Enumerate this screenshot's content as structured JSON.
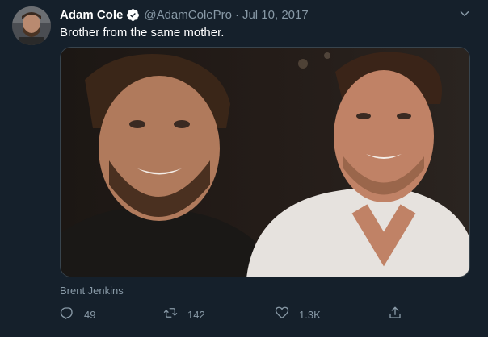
{
  "tweet": {
    "display_name": "Adam Cole",
    "verified": true,
    "handle": "@AdamColePro",
    "separator": "·",
    "date": "Jul 10, 2017",
    "text": "Brother from the same mother.",
    "media_tag": "Brent Jenkins",
    "actions": {
      "reply_count": "49",
      "retweet_count": "142",
      "like_count": "1.3K"
    }
  },
  "colors": {
    "background": "#15202b",
    "primary_text": "#ffffff",
    "secondary_text": "#8899a6",
    "verified_badge": "#ffffff",
    "media_border": "#38444d"
  },
  "icons": [
    "verified-badge-icon",
    "chevron-down-icon",
    "reply-icon",
    "retweet-icon",
    "like-icon",
    "share-icon"
  ]
}
